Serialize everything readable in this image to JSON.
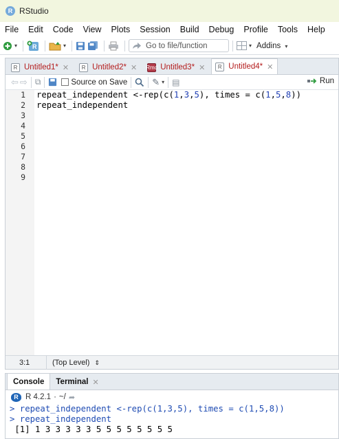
{
  "window": {
    "title": "RStudio",
    "logo_letter": "R"
  },
  "menu": [
    "File",
    "Edit",
    "Code",
    "View",
    "Plots",
    "Session",
    "Build",
    "Debug",
    "Profile",
    "Tools",
    "Help"
  ],
  "toolbar": {
    "goto_placeholder": "Go to file/function",
    "addins_label": "Addins",
    "icons": [
      "new-file-icon",
      "new-project-icon",
      "open-folder-icon",
      "save-icon",
      "save-all-icon",
      "print-icon",
      "grid-icon"
    ]
  },
  "editor": {
    "tabs": [
      {
        "label": "Untitled1*",
        "active": false
      },
      {
        "label": "Untitled2*",
        "active": false
      },
      {
        "label": "Untitled3*",
        "active": false
      },
      {
        "label": "Untitled4*",
        "active": true
      }
    ],
    "source_on_save_label": "Source on Save",
    "run_label": "Run",
    "line_numbers": [
      "1",
      "2",
      "3",
      "4",
      "5",
      "6",
      "7",
      "8",
      "9"
    ],
    "code": {
      "line1": "repeat_independent <-rep(c(1,3,5), times = c(1,5,8))",
      "line2": "repeat_independent"
    },
    "status": {
      "position": "3:1",
      "scope": "(Top Level)"
    }
  },
  "console": {
    "tabs": [
      {
        "label": "Console",
        "active": true
      },
      {
        "label": "Terminal",
        "active": false
      }
    ],
    "r_version": "R 4.2.1",
    "working_dir": "~/",
    "lines": [
      {
        "kind": "cmd",
        "text": "> repeat_independent <-rep(c(1,3,5), times = c(1,5,8))"
      },
      {
        "kind": "cmd",
        "text": "> repeat_independent"
      },
      {
        "kind": "res",
        "text": " [1] 1 3 3 3 3 3 5 5 5 5 5 5 5 5"
      }
    ]
  },
  "colors": {
    "titlebar_bg": "#f2f6df",
    "tab_text": "#b31b1b",
    "console_cmd": "#1e4bb3",
    "number_literal": "#1f3fb4"
  }
}
